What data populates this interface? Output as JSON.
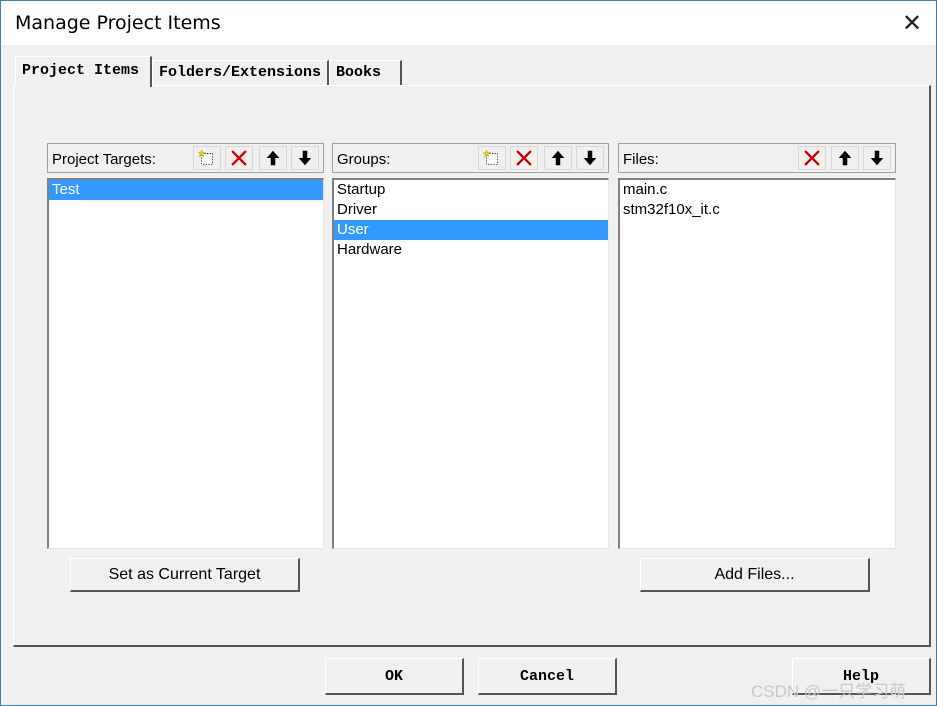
{
  "window": {
    "title": "Manage Project Items",
    "close_glyph": "✕"
  },
  "tabs": [
    {
      "label": "Project Items",
      "active": true
    },
    {
      "label": "Folders/Extensions",
      "active": false
    },
    {
      "label": "Books",
      "active": false
    }
  ],
  "targets": {
    "label": "Project Targets:",
    "items": [
      "Test"
    ],
    "selected": 0,
    "set_current_button": "Set as Current Target"
  },
  "groups": {
    "label": "Groups:",
    "items": [
      "Startup",
      "Driver",
      "User",
      "Hardware"
    ],
    "selected": 2
  },
  "files": {
    "label": "Files:",
    "items": [
      "main.c",
      "stm32f10x_it.c"
    ],
    "add_files_button": "Add Files..."
  },
  "footer": {
    "ok": "OK",
    "cancel": "Cancel",
    "help": "Help"
  },
  "watermark": "CSDN @一只学习萌",
  "colors": {
    "selection": "#3399ff",
    "delete_red": "#cc0000",
    "new_star": "#e8c000"
  }
}
